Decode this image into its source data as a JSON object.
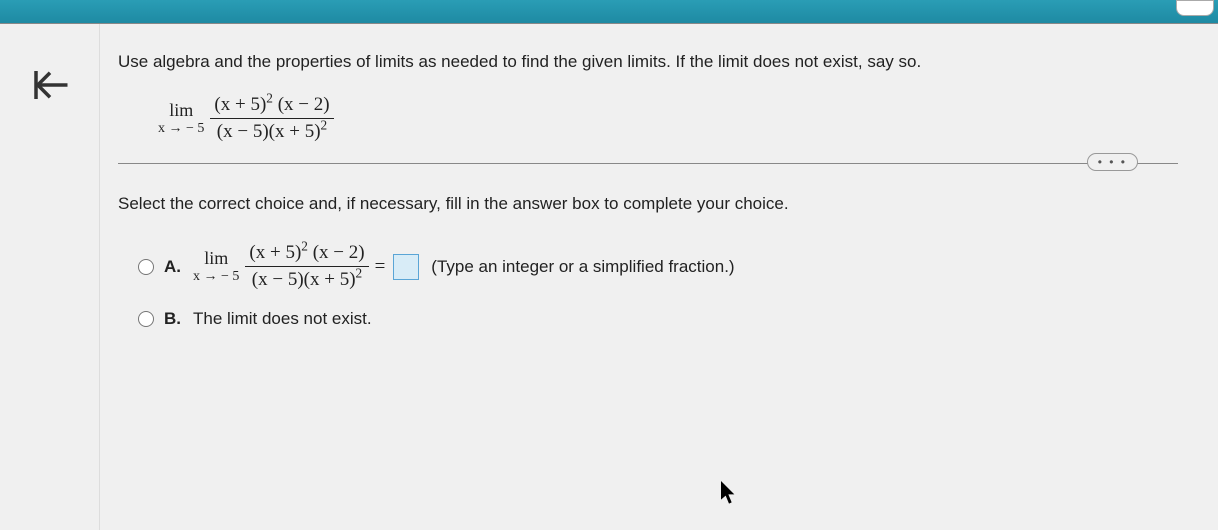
{
  "instruction": "Use algebra and the properties of limits as needed to find the given limits. If the limit does not exist, say so.",
  "limit": {
    "lim_label": "lim",
    "approach": "x → − 5",
    "numerator": "(x + 5)² (x − 2)",
    "denominator": "(x − 5)(x + 5)²"
  },
  "dots": "• • •",
  "select_text": "Select the correct choice and, if necessary, fill in the answer box to complete your choice.",
  "choice_a": {
    "label": "A.",
    "equals": "=",
    "hint": "(Type an integer or a simplified fraction.)"
  },
  "choice_b": {
    "label": "B.",
    "text": "The limit does not exist."
  }
}
